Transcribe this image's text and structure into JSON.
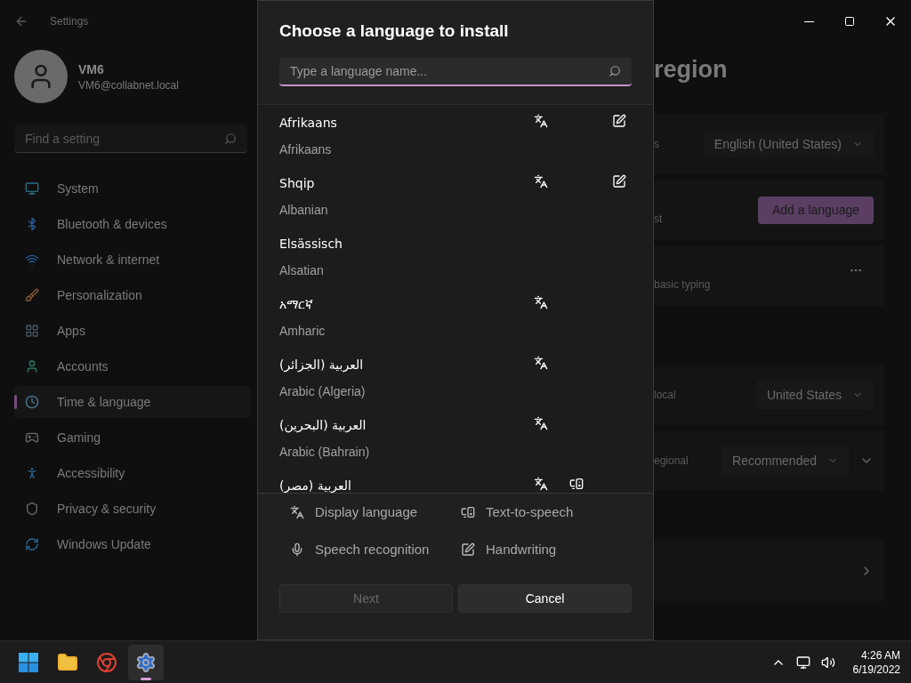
{
  "settings": {
    "title": "Settings",
    "user": {
      "name": "VM6",
      "email": "VM6@collabnet.local"
    },
    "search": {
      "placeholder": "Find a setting"
    },
    "nav": [
      {
        "label": "System",
        "selected": false
      },
      {
        "label": "Bluetooth & devices",
        "selected": false
      },
      {
        "label": "Network & internet",
        "selected": false
      },
      {
        "label": "Personalization",
        "selected": false
      },
      {
        "label": "Apps",
        "selected": false
      },
      {
        "label": "Accounts",
        "selected": false
      },
      {
        "label": "Time & language",
        "selected": true
      },
      {
        "label": "Gaming",
        "selected": false
      },
      {
        "label": "Accessibility",
        "selected": false
      },
      {
        "label": "Privacy & security",
        "selected": false
      },
      {
        "label": "Windows Update",
        "selected": false
      }
    ],
    "heading": "region",
    "cards": [
      {
        "kind": "dropdown",
        "label": "s",
        "value": "English (United States)"
      },
      {
        "kind": "button",
        "label": "st",
        "value": "Add a language"
      },
      {
        "kind": "more",
        "label": "basic typing"
      },
      {
        "kind": "dropdown",
        "label": "local",
        "value": "United States"
      },
      {
        "kind": "expand",
        "label": "egional",
        "value": "Recommended"
      },
      {
        "kind": "link"
      }
    ]
  },
  "dialog": {
    "title": "Choose a language to install",
    "search": {
      "placeholder": "Type a language name..."
    },
    "languages": [
      {
        "name": "Afrikaans",
        "english": "Afrikaans",
        "display_language": true,
        "handwriting": true,
        "text_to_speech": false
      },
      {
        "name": "Shqip",
        "english": "Albanian",
        "display_language": true,
        "handwriting": true,
        "text_to_speech": false
      },
      {
        "name": "Elsässisch",
        "english": "Alsatian",
        "display_language": false,
        "handwriting": false,
        "text_to_speech": false
      },
      {
        "name": "አማርኛ",
        "english": "Amharic",
        "display_language": true,
        "handwriting": false,
        "text_to_speech": false
      },
      {
        "name": "العربية (الجزائر)",
        "english": "Arabic (Algeria)",
        "display_language": true,
        "handwriting": false,
        "text_to_speech": false
      },
      {
        "name": "العربية (البحرين)",
        "english": "Arabic (Bahrain)",
        "display_language": true,
        "handwriting": false,
        "text_to_speech": false
      },
      {
        "name": "العربية (مصر)",
        "display_language": true,
        "handwriting": false,
        "text_to_speech": true
      }
    ],
    "legend": [
      {
        "kind": "display",
        "label": "Display language"
      },
      {
        "kind": "tts",
        "label": "Text-to-speech"
      },
      {
        "kind": "speech",
        "label": "Speech recognition"
      },
      {
        "kind": "handwriting",
        "label": "Handwriting"
      }
    ],
    "buttons": [
      {
        "label": "Next",
        "disabled": true
      },
      {
        "label": "Cancel",
        "disabled": false
      }
    ]
  },
  "taskbar": {
    "apps": [
      {
        "kind": "start",
        "selected": false
      },
      {
        "kind": "explorer",
        "selected": false
      },
      {
        "kind": "browser",
        "selected": false
      },
      {
        "kind": "settings",
        "selected": true
      }
    ],
    "time": "4:26 AM",
    "date": "6/19/2022"
  }
}
